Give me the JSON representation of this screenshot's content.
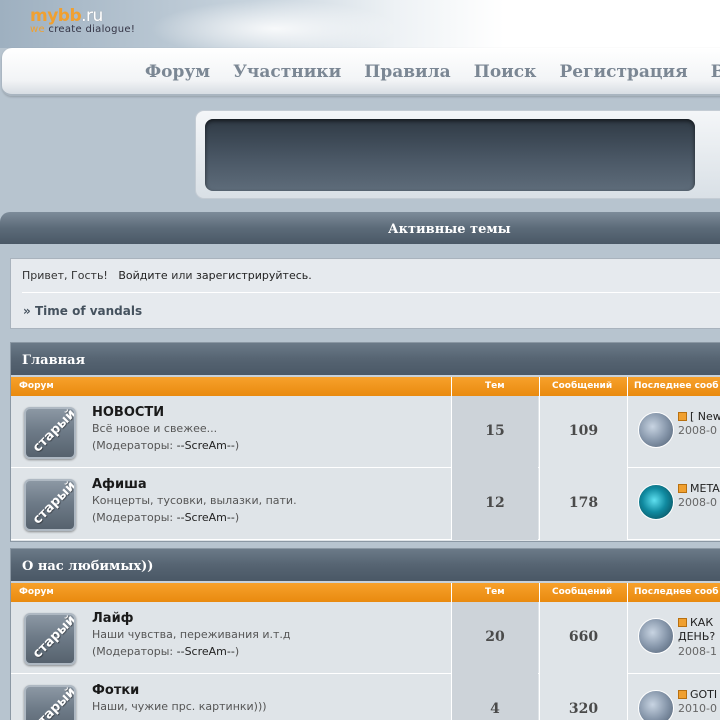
{
  "logo": {
    "brand_main": "mybb",
    "brand_suffix": ".ru",
    "tagline_1": "we",
    "tagline_2": "create",
    "tagline_3": "dialogue!"
  },
  "nav": [
    "Форум",
    "Участники",
    "Правила",
    "Поиск",
    "Регистрация",
    "Во"
  ],
  "active_topics": "Активные темы",
  "welcome": {
    "greeting": "Привет, Гость!",
    "login": "Войдите",
    "or": "или",
    "register": "зарегистрируйтесь.",
    "crumb_prefix": "»",
    "crumb": "Time of vandals"
  },
  "columns": {
    "forum": "Форум",
    "topics": "Тем",
    "posts": "Сообщений",
    "last": "Последнее сооб"
  },
  "categories": [
    {
      "title": "Главная",
      "forums": [
        {
          "icon_label": "старый",
          "name": "НОВОСТИ",
          "desc": "Всё новое и свежее...",
          "mods_label": "(Модераторы:",
          "mod": "--ScreAm--",
          "mods_close": ")",
          "topics": "15",
          "posts": "109",
          "last_title": "[ New",
          "last_date": "2008-0"
        },
        {
          "icon_label": "старый",
          "name": "Афиша",
          "desc": "Концерты, тусовки, вылазки, пати.",
          "mods_label": "(Модераторы:",
          "mod": "--ScreAm--",
          "mods_close": ")",
          "topics": "12",
          "posts": "178",
          "last_title": "META",
          "last_date": "2008-0"
        }
      ]
    },
    {
      "title": "О нас любимых))",
      "forums": [
        {
          "icon_label": "старый",
          "name": "Лайф",
          "desc": "Наши чувства, переживания и.т.д",
          "mods_label": "(Модераторы:",
          "mod": "--ScreAm--",
          "mods_close": ")",
          "topics": "20",
          "posts": "660",
          "last_title": "КАК ДЕНЬ?",
          "last_date": "2008-1"
        },
        {
          "icon_label": "старый",
          "name": "Фотки",
          "desc": "Наши, чужие прс. картинки)))",
          "topics": "4",
          "posts": "320",
          "last_title": "GOTI",
          "last_date": "2010-0"
        }
      ]
    }
  ],
  "colors": {
    "accent_orange": "#f0a030",
    "header_dark": "#566472",
    "nav_text": "#7b8794"
  }
}
